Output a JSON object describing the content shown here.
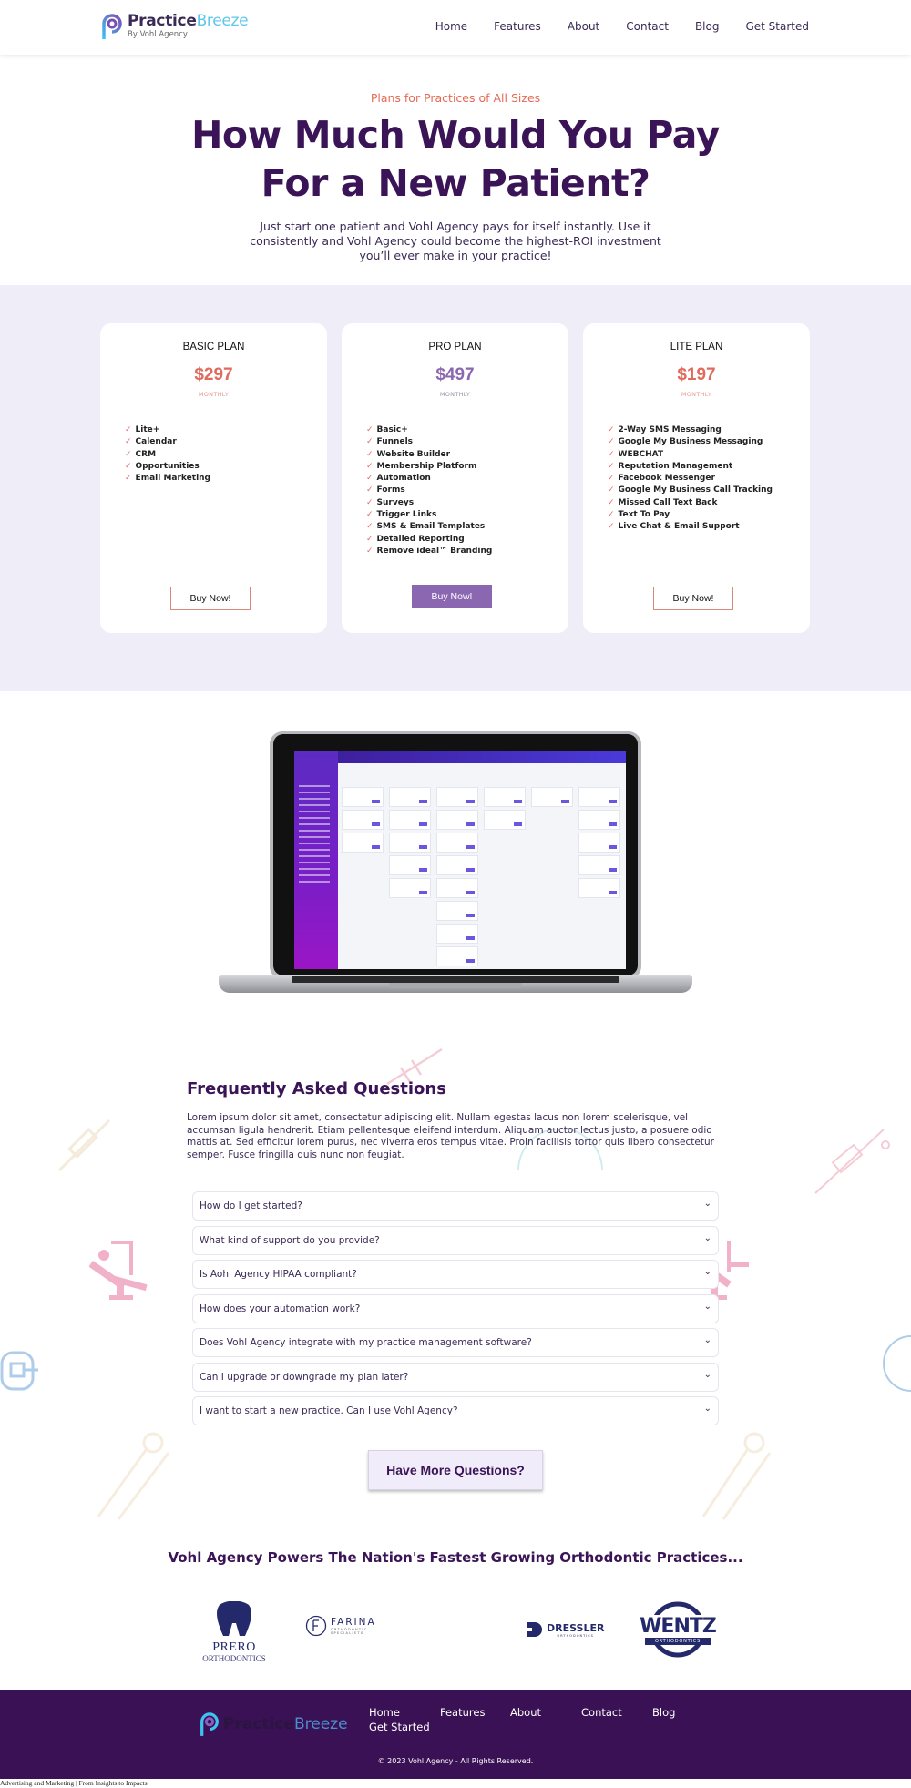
{
  "header": {
    "logo": {
      "word_bold": "Practice",
      "word_light": "Breeze",
      "sub": "By Vohl Agency"
    },
    "nav": [
      "Home",
      "Features",
      "About",
      "Contact",
      "Blog",
      "Get Started"
    ]
  },
  "hero": {
    "eyebrow": "Plans for Practices of All Sizes",
    "headline_line1": "How Much Would You Pay",
    "headline_line2": "For a New Patient?",
    "subtext": "Just start one patient and Vohl Agency pays for itself instantly. Use it consistently and Vohl Agency could become the highest-ROI investment you’ll ever make in your practice!"
  },
  "pricing": {
    "plans": [
      {
        "name": "BASIC PLAN",
        "price": "$297",
        "period": "MONTHLY",
        "price_color": "#e06a5c",
        "features": [
          "Lite+",
          "Calendar",
          "CRM",
          "Opportunities",
          "Email Marketing"
        ],
        "button": "Buy Now!"
      },
      {
        "name": "PRO PLAN",
        "price": "$497",
        "period": "MONTHLY",
        "price_color": "#8a67b0",
        "features": [
          "Basic+",
          "Funnels",
          "Website Builder",
          "Membership Platform",
          "Automation",
          "Forms",
          "Surveys",
          "Trigger Links",
          "SMS & Email Templates",
          "Detailed Reporting",
          "Remove ideal™ Branding"
        ],
        "button": "Buy Now!"
      },
      {
        "name": "LITE PLAN",
        "price": "$197",
        "period": "MONTHLY",
        "price_color": "#e06a5c",
        "features": [
          "2-Way SMS Messaging",
          "Google My Business Messaging",
          "WEBCHAT",
          "Reputation Management",
          "Facebook Messenger",
          "Google My Business Call Tracking",
          "Missed Call Text Back",
          "Text To Pay",
          "Live Chat & Email Support"
        ],
        "button": "Buy Now!"
      }
    ],
    "check_icon": "✓"
  },
  "showcase": {
    "image": "laptop-dashboard-screenshot"
  },
  "faq": {
    "title": "Frequently Asked Questions",
    "description": "Lorem ipsum dolor sit amet, consectetur adipiscing elit. Nullam egestas lacus non lorem scelerisque, vel accumsan ligula hendrerit. Etiam pellentesque eleifend interdum. Aliquam auctor lectus justo, a posuere odio mattis at. Sed efficitur lorem purus, nec viverra eros tempus vitae. Proin facilisis tortor quis libero consectetur semper. Fusce fringilla quis nunc non feugiat.",
    "questions": [
      "How do I get started?",
      "What kind of support do you provide?",
      "Is Aohl Agency HIPAA compliant?",
      "How does your automation work?",
      "Does Vohl Agency integrate with my practice management software?",
      "Can I upgrade or downgrade my plan later?",
      "I want to start a new practice. Can I use Vohl Agency?"
    ],
    "chevron_icon": "⌄",
    "more_button": "Have More Questions?"
  },
  "clients": {
    "title": "Vohl Agency Powers The Nation's Fastest Growing Orthodontic Practices...",
    "logos": [
      {
        "name": "PRERO",
        "sub": "ORTHODONTICS"
      },
      {
        "name": "FARINA",
        "sub": "ORTHODONTIC SPECIALISTS"
      },
      {
        "name": "DRESSLER",
        "sub": "ORTHODONTICS"
      },
      {
        "name": "WENTZ",
        "sub": "ORTHODONTICS"
      }
    ]
  },
  "footer": {
    "nav": [
      "Home",
      "Features",
      "About",
      "Contact",
      "Blog",
      "Get Started"
    ],
    "copyright": "© 2023 Vohl Agency - All Rights Reserved."
  },
  "tagline": "Advertising and Marketing | From Insights to Impacts",
  "colors": {
    "brand_dark": "#3a1456",
    "accent_coral": "#e56a55",
    "accent_purple": "#8a67b0",
    "section_bg": "#efedf7",
    "footer_bg": "#3a1154"
  }
}
